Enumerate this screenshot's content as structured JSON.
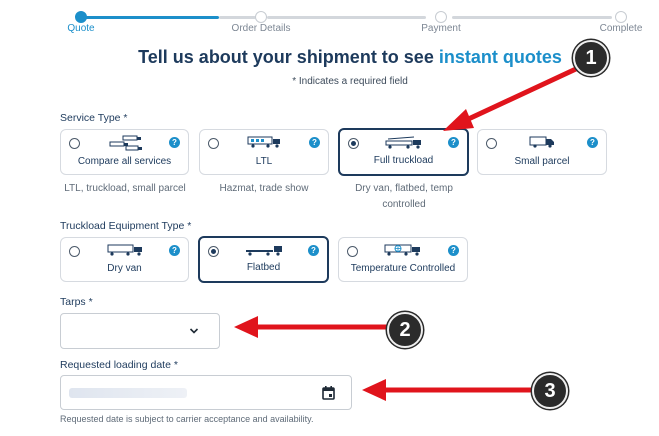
{
  "stepper": {
    "steps": [
      {
        "label": "Quote",
        "active": true
      },
      {
        "label": "Order Details",
        "active": false
      },
      {
        "label": "Payment",
        "active": false
      },
      {
        "label": "Complete",
        "active": false
      }
    ],
    "progress": 0.36
  },
  "headline": {
    "main": "Tell us about your shipment to see ",
    "accent": "instant quotes"
  },
  "required_note": "* Indicates a required field",
  "service_type": {
    "label": "Service Type *",
    "options": [
      {
        "label": "Compare all services",
        "description": "LTL, truckload, small parcel",
        "selected": false
      },
      {
        "label": "LTL",
        "description": "Hazmat, trade show",
        "selected": false
      },
      {
        "label": "Full truckload",
        "description": "Dry van, flatbed, temp controlled",
        "selected": true
      },
      {
        "label": "Small parcel",
        "description": "",
        "selected": false
      }
    ]
  },
  "equipment_type": {
    "label": "Truckload Equipment Type *",
    "options": [
      {
        "label": "Dry van",
        "selected": false
      },
      {
        "label": "Flatbed",
        "selected": true
      },
      {
        "label": "Temperature Controlled",
        "selected": false
      }
    ]
  },
  "tarps": {
    "label": "Tarps *",
    "value": ""
  },
  "loading_date": {
    "label": "Requested loading date *",
    "note": "Requested date is subject to carrier acceptance and availability."
  },
  "help_glyph": "?",
  "icons": {
    "help": "question-circle-icon",
    "dropdown": "chevron-down-icon",
    "calendar": "calendar-icon"
  },
  "annotations": [
    {
      "number": "1"
    },
    {
      "number": "2"
    },
    {
      "number": "3"
    }
  ],
  "colors": {
    "accent": "#1c8fca",
    "navy": "#1d3a5c",
    "arrow_red": "#e0141c",
    "badge": "#2b2b2b"
  }
}
